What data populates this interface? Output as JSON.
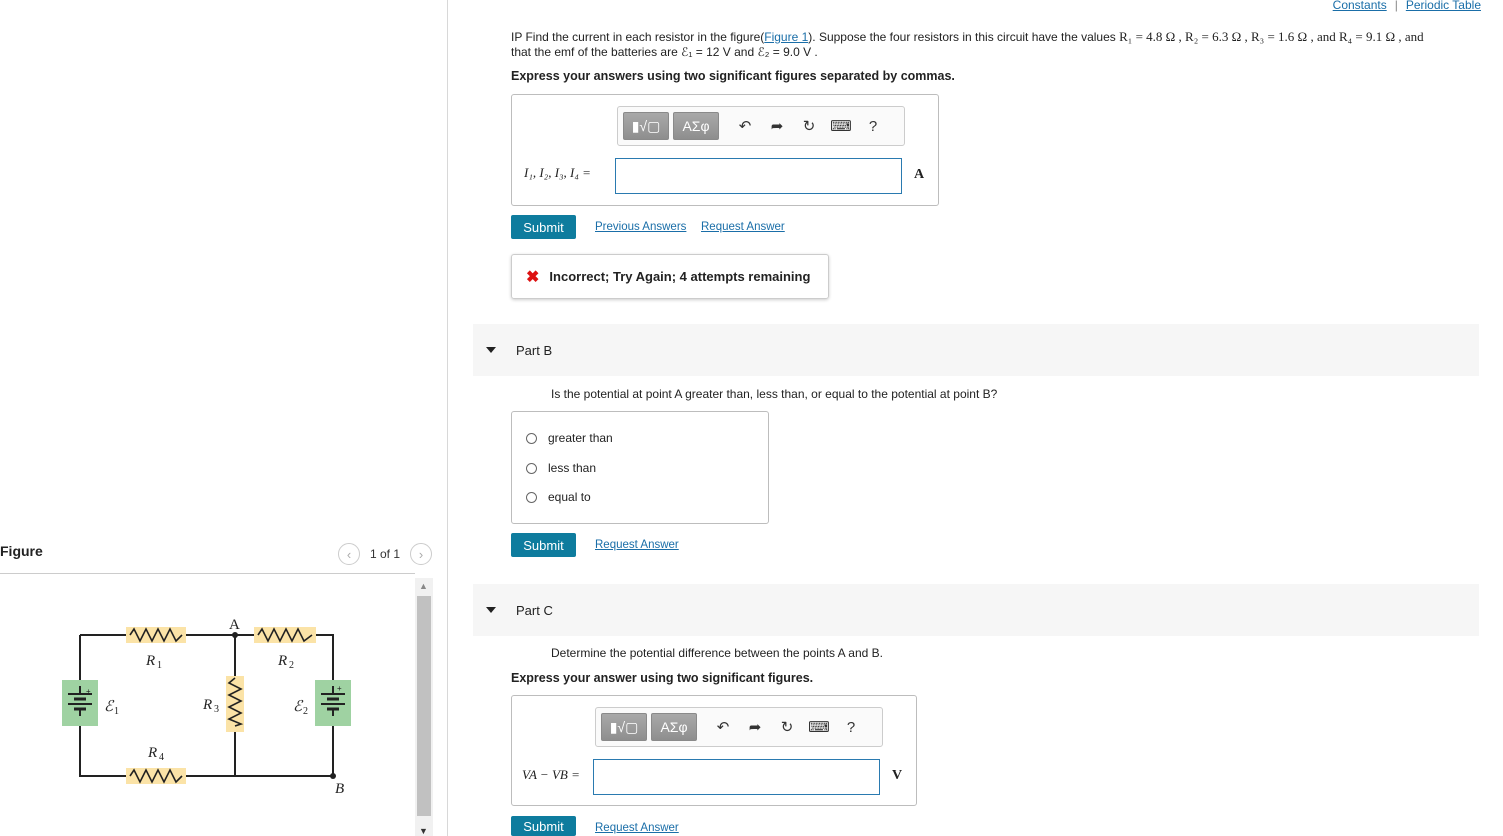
{
  "figure_panel": {
    "label": "Figure",
    "pager_text": "1 of 1",
    "circuit_labels": {
      "point_a": "A",
      "point_b": "B",
      "r1": "R",
      "r1_sub": "1",
      "r2": "R",
      "r2_sub": "2",
      "r3": "R",
      "r3_sub": "3",
      "r4": "R",
      "r4_sub": "4",
      "emf1": "ℰ",
      "emf1_sub": "1",
      "emf2": "ℰ",
      "emf2_sub": "2"
    }
  },
  "topnav": {
    "constants": "Constants",
    "separator": "|",
    "periodic_table": "Periodic Table"
  },
  "question": {
    "prefix": "IP  Find the current in each resistor in the figure(",
    "figure_link": "Figure 1",
    "mid": "). Suppose the four resistors in this circuit have the values ",
    "r_values": "R₁ = 4.8 Ω , R₂ = 6.3 Ω , R₃ = 1.6 Ω , and R₄ = 9.1 Ω , and",
    "line2": "that the emf of the batteries are ℰ₁ = 12 V and ℰ₂ = 9.0 V ."
  },
  "part_a": {
    "instruction": "Express your answers using two significant figures separated by commas.",
    "toolbar": {
      "templates": "▮√▢",
      "symbols": "ΑΣφ",
      "help": "?"
    },
    "input_label": "I₁, I₂, I₃, I₄ =",
    "input_value": "",
    "unit": "A",
    "submit": "Submit",
    "previous_answers": "Previous Answers",
    "request_answer": "Request Answer",
    "feedback": "Incorrect; Try Again; 4 attempts remaining"
  },
  "part_b": {
    "title": "Part B",
    "question": "Is the potential at point A greater than, less than, or equal to the potential at point B?",
    "options": [
      "greater than",
      "less than",
      "equal to"
    ],
    "submit": "Submit",
    "request_answer": "Request Answer"
  },
  "part_c": {
    "title": "Part C",
    "question": "Determine the potential difference between the points A and B.",
    "instruction": "Express your answer using two significant figures.",
    "toolbar": {
      "templates": "▮√▢",
      "symbols": "ΑΣφ",
      "help": "?"
    },
    "input_label": "VA − VB =",
    "input_value": "",
    "unit": "V",
    "submit": "Submit",
    "request_answer": "Request Answer"
  },
  "colors": {
    "submit": "#0e7c9e",
    "link": "#1a6ea8",
    "resistor_bg": "#fbe3a7",
    "battery_bg": "#9fd2a2"
  }
}
